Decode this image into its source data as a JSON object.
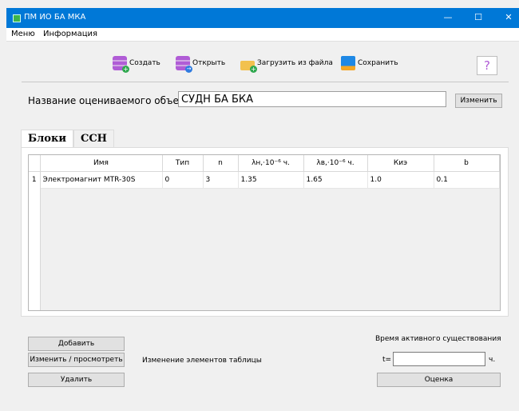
{
  "window": {
    "title": "ПМ ИО БА МКА",
    "controls": {
      "minimize": "—",
      "maximize": "☐",
      "close": "✕"
    }
  },
  "menu": [
    "Меню",
    "Информация"
  ],
  "toolbar": {
    "create_label": "Создать",
    "open_label": "Открыть",
    "load_label": "Загрузить из файла",
    "save_label": "Сохранить",
    "help_label": "?"
  },
  "object": {
    "label": "Название оцениваемого объекта",
    "value": "СУДН БА БКА",
    "change_button": "Изменить"
  },
  "tabs": [
    {
      "label": "Блоки",
      "active": true
    },
    {
      "label": "ССН",
      "active": false
    }
  ],
  "table": {
    "columns": [
      "Имя",
      "Тип",
      "n",
      "λн,·10⁻⁶ ч.",
      "λв,·10⁻⁶ ч.",
      "Киэ",
      "b"
    ],
    "rows": [
      {
        "num": "1",
        "cells": [
          "Электромагнит MTR-30S",
          "0",
          "3",
          "1.35",
          "1.65",
          "1.0",
          "0.1"
        ]
      }
    ]
  },
  "actions": {
    "add": "Добавить",
    "edit": "Изменить / просмотреть",
    "delete": "Удалить",
    "edit_hint": "Изменение элементов таблицы"
  },
  "active_time": {
    "label": "Время активного существования",
    "t_label": "t=",
    "t_value": "",
    "unit": "ч.",
    "evaluate_button": "Оценка"
  },
  "colors": {
    "titlebar": "#0078d7",
    "db_icon": "#b05cd6",
    "plus": "#2fa84f"
  }
}
